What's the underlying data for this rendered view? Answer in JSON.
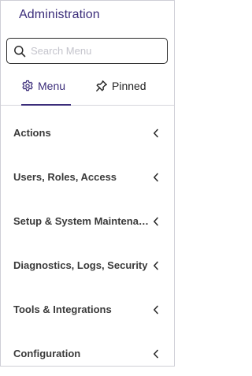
{
  "panel": {
    "title": "Administration"
  },
  "search": {
    "placeholder": "Search Menu",
    "value": "",
    "icon": "search-icon"
  },
  "tabs": [
    {
      "label": "Menu",
      "icon": "gear-icon",
      "active": true
    },
    {
      "label": "Pinned",
      "icon": "pin-icon",
      "active": false
    }
  ],
  "menu": {
    "items": [
      {
        "label": "Actions"
      },
      {
        "label": "Users, Roles, Access"
      },
      {
        "label": "Setup & System Maintena…"
      },
      {
        "label": "Diagnostics, Logs, Security"
      },
      {
        "label": "Tools & Integrations"
      },
      {
        "label": "Configuration"
      }
    ]
  },
  "colors": {
    "accent": "#3b2d7a",
    "text": "#3a3a3a",
    "border": "#cfcfd6",
    "placeholder": "#c4c4cc"
  }
}
